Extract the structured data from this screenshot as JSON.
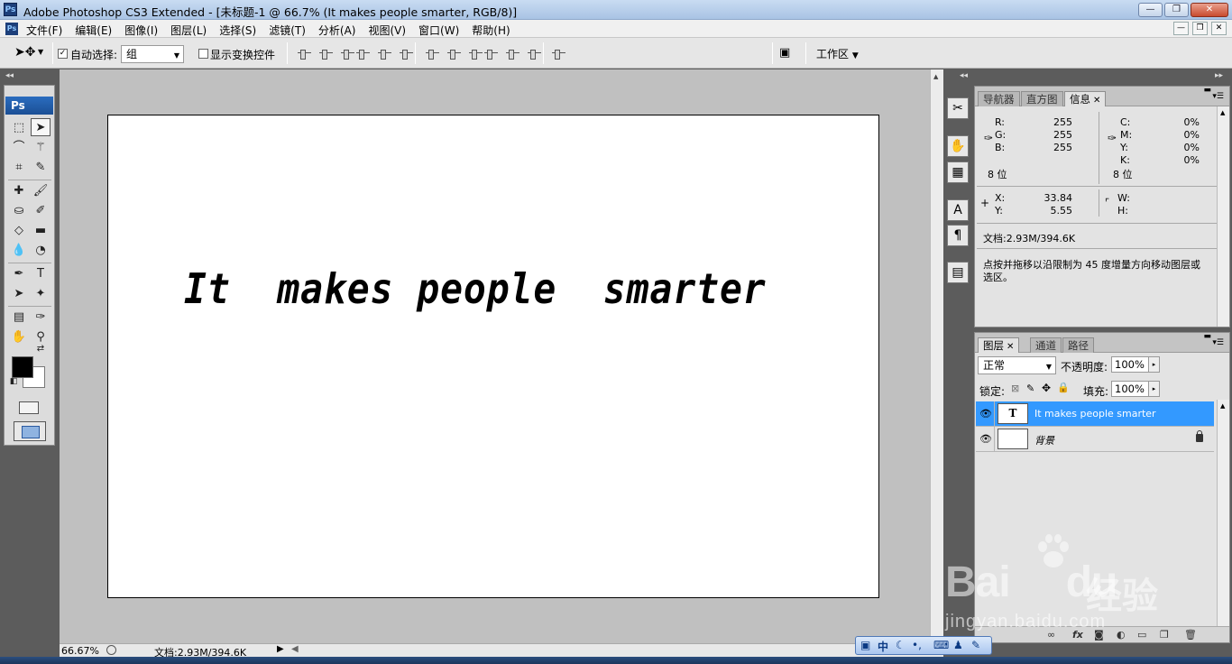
{
  "window": {
    "title": "Adobe Photoshop CS3 Extended - [未标题-1 @ 66.7% (It  makes people  smarter, RGB/8)]",
    "app_logo": "Ps",
    "minimize": "—",
    "maximize": "❐",
    "close": "✕"
  },
  "menubar": {
    "items": [
      "文件(F)",
      "编辑(E)",
      "图像(I)",
      "图层(L)",
      "选择(S)",
      "滤镜(T)",
      "分析(A)",
      "视图(V)",
      "窗口(W)",
      "帮助(H)"
    ],
    "doc_minimize": "—",
    "doc_restore": "❐",
    "doc_close": "✕"
  },
  "options": {
    "auto_select_label": "自动选择:",
    "auto_select_checked": "✓",
    "auto_select_value": "组",
    "show_transform_label": "显示变换控件",
    "workspace_label": "工作区"
  },
  "toolbox": {
    "header": "Ps",
    "foreground_color": "#000000",
    "background_color": "#ffffff"
  },
  "canvas": {
    "text": "It  makes people  smarter"
  },
  "statusbar": {
    "zoom": "66.67%",
    "doc_info": "文档:2.93M/394.6K"
  },
  "info_panel": {
    "tabs": [
      "导航器",
      "直方图",
      "信息"
    ],
    "active_tab": "信息",
    "rgb": {
      "r_label": "R:",
      "g_label": "G:",
      "b_label": "B:",
      "r": "255",
      "g": "255",
      "b": "255",
      "bits": "8 位"
    },
    "cmyk": {
      "c_label": "C:",
      "m_label": "M:",
      "y_label": "Y:",
      "k_label": "K:",
      "c": "0%",
      "m": "0%",
      "y": "0%",
      "k": "0%",
      "bits": "8 位"
    },
    "pos": {
      "x_label": "X:",
      "y_label": "Y:",
      "x": "33.84",
      "y": "5.55"
    },
    "size": {
      "w_label": "W:",
      "h_label": "H:"
    },
    "doc_info": "文档:2.93M/394.6K",
    "hint_line1": "点按并拖移以沿限制为 45 度增量方向移动图层或",
    "hint_line2": "选区。"
  },
  "layers_panel": {
    "tabs": [
      "图层",
      "通道",
      "路径"
    ],
    "blend_mode": "正常",
    "opacity_label": "不透明度:",
    "opacity": "100%",
    "lock_label": "锁定:",
    "fill_label": "填充:",
    "fill": "100%",
    "layers": [
      {
        "name": "It  makes people  smarter",
        "thumb": "T",
        "selected": true
      },
      {
        "name": "背景",
        "thumb": "",
        "locked": true
      }
    ]
  },
  "ime": {
    "mode": "中"
  },
  "watermark": {
    "brand": "Bai",
    "brand2": "du",
    "brand_cn": "经验",
    "url": "jingyan.baidu.com"
  }
}
